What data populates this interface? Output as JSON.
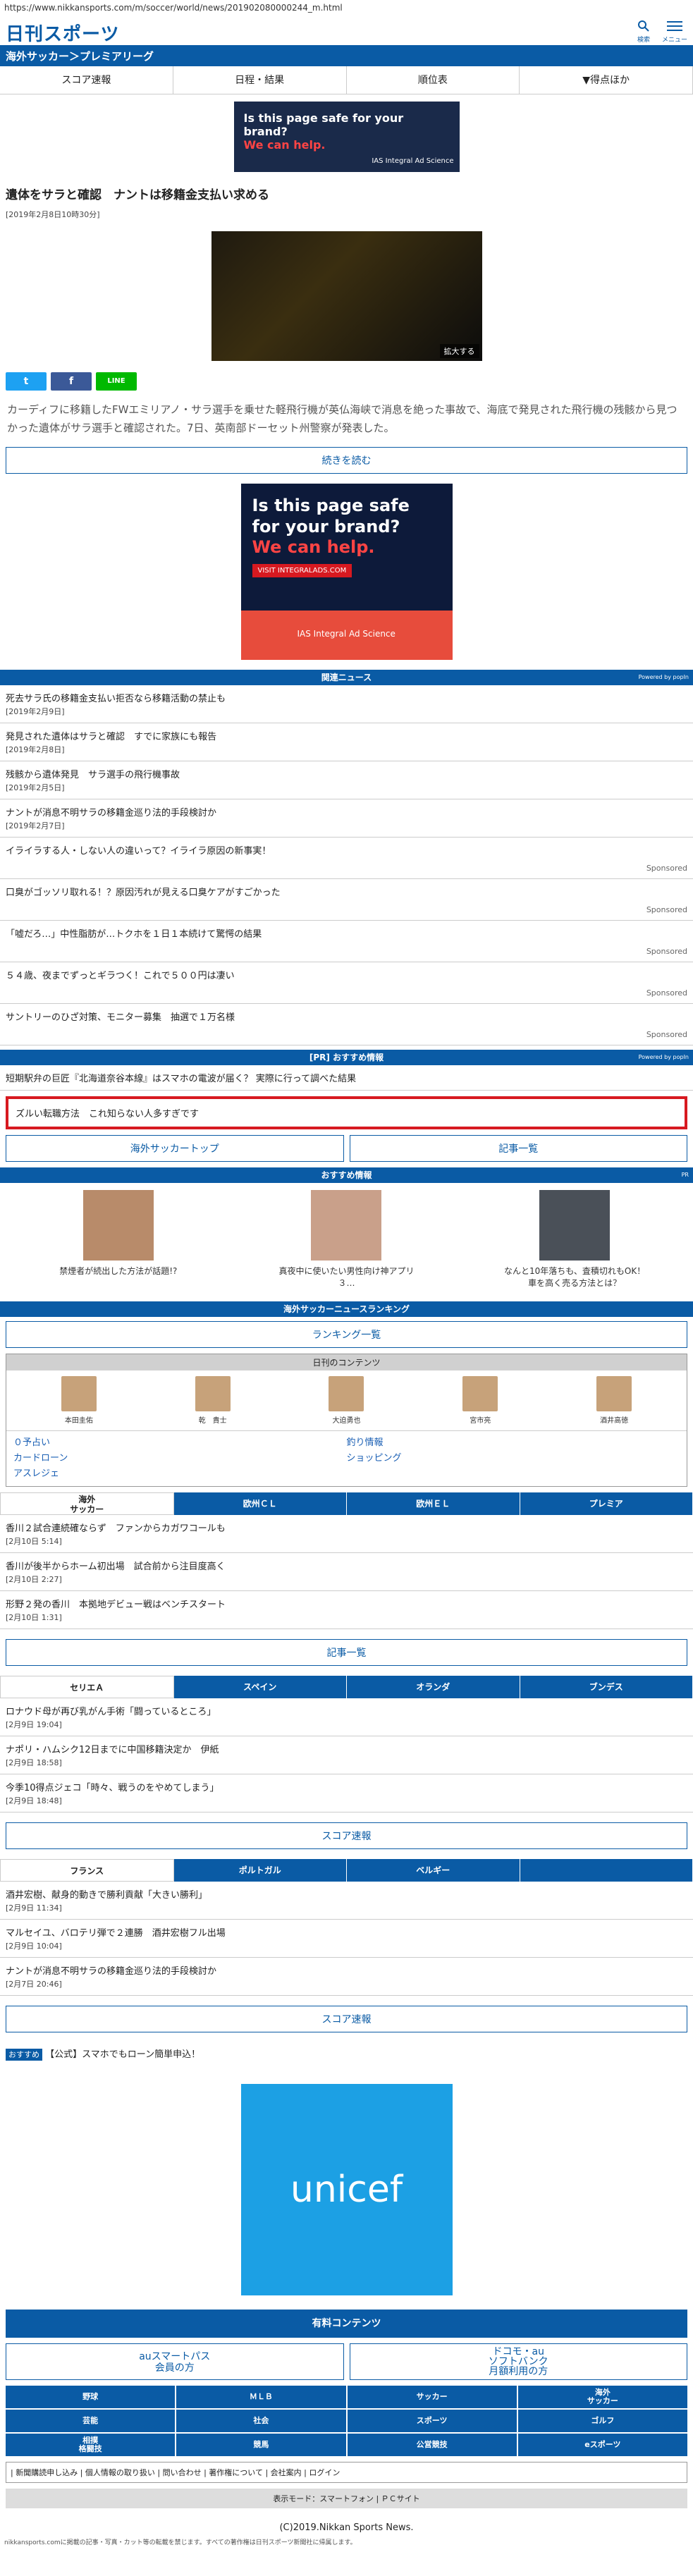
{
  "url": "https://www.nikkansports.com/m/soccer/world/news/201902080000244_m.html",
  "logo": "日刊スポーツ",
  "search_label": "検索",
  "menu_label": "メニュー",
  "breadcrumb": "海外サッカー＞プレミアリーグ",
  "tabs": [
    "スコア速報",
    "日程・結果",
    "順位表",
    "▼得点ほか"
  ],
  "ad1": {
    "line1": "Is this page safe for your brand?",
    "line2": "We can help.",
    "brand": "IAS Integral Ad Science"
  },
  "article": {
    "title": "遺体をサラと確認　ナントは移籍金支払い求める",
    "date": "[2019年2月8日10時30分]",
    "zoom": "拡大する",
    "lead": "カーディフに移籍したFWエミリアノ・サラ選手を乗せた軽飛行機が英仏海峡で消息を絶った事故で、海底で発見された飛行機の残骸から見つかった遺体がサラ選手と確認された。7日、英南部ドーセット州警察が発表した。",
    "more": "続きを読む"
  },
  "share": {
    "twitter": "t",
    "facebook": "f",
    "line": "LINE"
  },
  "ad2": {
    "line1": "Is this page safe for your brand?",
    "line2": "We can help.",
    "visit": "VISIT INTEGRALADS.COM",
    "brand": "IAS Integral Ad Science"
  },
  "related": {
    "heading": "関連ニュース",
    "powered": "Powered by popIn",
    "items": [
      {
        "t": "死去サラ氏の移籍金支払い拒否なら移籍活動の禁止も",
        "d": "[2019年2月9日]"
      },
      {
        "t": "発見された遺体はサラと確認　すでに家族にも報告",
        "d": "[2019年2月8日]"
      },
      {
        "t": "残骸から遺体発見　サラ選手の飛行機事故",
        "d": "[2019年2月5日]"
      },
      {
        "t": "ナントが消息不明サラの移籍金巡り法的手段検討か",
        "d": "[2019年2月7日]"
      }
    ],
    "sponsored": [
      {
        "t": "イライラする人・しない人の違いって？イライラ原因の新事実！",
        "s": "Sponsored"
      },
      {
        "t": "口臭がゴッソリ取れる！？原因汚れが見える口臭ケアがすごかった",
        "s": "Sponsored"
      },
      {
        "t": "「嘘だろ…」中性脂肪が…トクホを１日１本続けて驚愕の結果",
        "s": "Sponsored"
      },
      {
        "t": "５４歳、夜までずっとギラつく！これで５００円は凄い",
        "s": "Sponsored"
      },
      {
        "t": "サントリーのひざ対策、モニター募集　抽選で１万名様",
        "s": "Sponsored"
      }
    ]
  },
  "pr": {
    "heading": "[PR] おすすめ情報",
    "powered": "Powered by popIn",
    "item": "短期駅弁の巨匠『北海道奈谷本線』はスマホの電波が届く？ 実際に行って調べた結果"
  },
  "prbox": "ズルい転職方法　これ知らない人多すぎです",
  "btn_top": "海外サッカートップ",
  "btn_list": "記事一覧",
  "osusume": {
    "heading": "おすすめ情報",
    "pr": "PR",
    "items": [
      "禁煙者が続出した方法が話題!?",
      "真夜中に使いたい男性向け神アプリ３…",
      "なんと10年落ちも、査積切れもOK！車を高く売る方法とは？"
    ]
  },
  "ranking": {
    "heading": "海外サッカーニュースランキング",
    "btn": "ランキング一覧"
  },
  "mycontent": {
    "heading": "日刊のコンテンツ",
    "people": [
      "本田圭佑",
      "乾　貴士",
      "大迫勇也",
      "宮市亮",
      "酒井高徳"
    ],
    "links": [
      "０予占い",
      "カードローン",
      "アスレジェ",
      "釣り情報",
      "ショッピング",
      ""
    ]
  },
  "league_tabs1": [
    "海外\nサッカー",
    "欧州ＣＬ",
    "欧州ＥＬ",
    "プレミア"
  ],
  "news1": [
    {
      "t": "香川２試合連続確ならず　ファンからカガワコールも",
      "d": "[2月10日 5:14]"
    },
    {
      "t": "香川が後半からホーム初出場　試合前から注目度高く",
      "d": "[2月10日 2:27]"
    },
    {
      "t": "形野２発の香川　本拠地デビュー戦はベンチスタート",
      "d": "[2月10日 1:31]"
    }
  ],
  "btn_list2": "記事一覧",
  "league_tabs2": [
    "セリエＡ",
    "スペイン",
    "オランダ",
    "ブンデス"
  ],
  "news2": [
    {
      "t": "ロナウド母が再び乳がん手術「闘っているところ」",
      "d": "[2月9日 19:04]"
    },
    {
      "t": "ナポリ・ハムシク12日までに中国移籍決定か　伊紙",
      "d": "[2月9日 18:58]"
    },
    {
      "t": "今季10得点ジェコ「時々、戦うのをやめてしまう」",
      "d": "[2月9日 18:48]"
    }
  ],
  "btn_score": "スコア速報",
  "league_tabs3": [
    "フランス",
    "ポルトガル",
    "ベルギー",
    ""
  ],
  "news3": [
    {
      "t": "酒井宏樹、献身的動きで勝利貢献「大きい勝利」",
      "d": "[2月9日 11:34]"
    },
    {
      "t": "マルセイユ、バロテリ弾で２連勝　酒井宏樹フル出場",
      "d": "[2月9日 10:04]"
    },
    {
      "t": "ナントが消息不明サラの移籍金巡り法的手段検討か",
      "d": "[2月7日 20:46]"
    }
  ],
  "btn_score2": "スコア速報",
  "promo": {
    "tag": "おすすめ",
    "text": "【公式】スマホでもローン簡単申込！"
  },
  "unicef": "unicef",
  "paid": {
    "heading": "有料コンテンツ",
    "btns": [
      "auスマートパス\n会員の方",
      "ドコモ・au\nソフトバンク\n月額利用の方"
    ]
  },
  "nav": [
    "野球",
    "ＭＬＢ",
    "サッカー",
    "海外\nサッカー",
    "芸能",
    "社会",
    "スポーツ",
    "ゴルフ",
    "相撲\n格闘技",
    "競馬",
    "公営競技",
    "eスポーツ"
  ],
  "footlinks": "| 新聞購読申し込み | 個人情報の取り扱い | 問い合わせ | 著作権について | 会社案内 | ログイン",
  "mode": "表示モード：スマートフォン | ＰＣサイト",
  "copyright": "(C)2019.Nikkan Sports News.",
  "fine": "nikkansports.comに掲載の記事・写真・カット等の転載を禁じます。すべての著作権は日刊スポーツ新聞社に帰属します。"
}
